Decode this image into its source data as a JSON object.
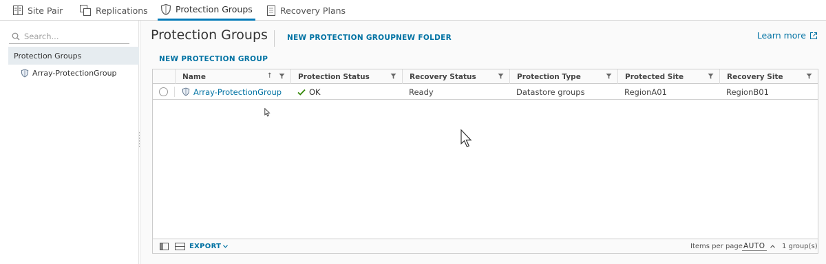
{
  "tabs": [
    {
      "label": "Site Pair",
      "icon": "site-pair-icon",
      "active": false
    },
    {
      "label": "Replications",
      "icon": "replications-icon",
      "active": false
    },
    {
      "label": "Protection Groups",
      "icon": "shield-icon",
      "active": true
    },
    {
      "label": "Recovery Plans",
      "icon": "recovery-plan-icon",
      "active": false
    }
  ],
  "sidebar": {
    "search_placeholder": "Search...",
    "selected_item": "Protection Groups",
    "children": [
      {
        "label": "Array-ProtectionGroup",
        "icon": "shield-icon"
      }
    ]
  },
  "header": {
    "title": "Protection Groups",
    "actions": [
      "NEW PROTECTION GROUP",
      "NEW FOLDER"
    ],
    "learn_more": "Learn more",
    "sub_action": "NEW PROTECTION GROUP"
  },
  "grid": {
    "columns": [
      "Name",
      "Protection Status",
      "Recovery Status",
      "Protection Type",
      "Protected Site",
      "Recovery Site"
    ],
    "sort_indicator": "↑",
    "rows": [
      {
        "name": "Array-ProtectionGroup",
        "protection_status": "OK",
        "recovery_status": "Ready",
        "protection_type": "Datastore groups",
        "protected_site": "RegionA01",
        "recovery_site": "RegionB01"
      }
    ],
    "footer": {
      "export_label": "EXPORT",
      "items_per_page_label": "Items per page",
      "items_per_page_value": "AUTO",
      "count_label": "1 group(s)"
    }
  },
  "colors": {
    "accent": "#0072a3",
    "active_tab_underline": "#0079b8",
    "ok_check": "#2f8400",
    "selected_bg": "#e6ecf0"
  }
}
